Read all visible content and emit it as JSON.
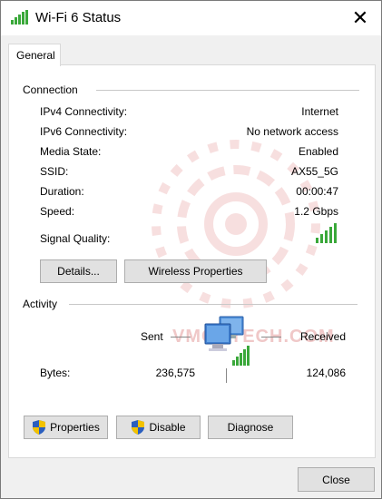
{
  "window": {
    "title": "Wi-Fi 6 Status",
    "close_glyph": "✕"
  },
  "tabs": [
    {
      "label": "General"
    }
  ],
  "connection": {
    "heading": "Connection",
    "rows": [
      {
        "label": "IPv4 Connectivity:",
        "value": "Internet"
      },
      {
        "label": "IPv6 Connectivity:",
        "value": "No network access"
      },
      {
        "label": "Media State:",
        "value": "Enabled"
      },
      {
        "label": "SSID:",
        "value": "AX55_5G"
      },
      {
        "label": "Duration:",
        "value": "00:00:47"
      },
      {
        "label": "Speed:",
        "value": "1.2 Gbps"
      }
    ],
    "signal_label": "Signal Quality:",
    "signal_bars_filled": 5,
    "signal_bars_total": 5,
    "details_label": "Details...",
    "wireless_properties_label": "Wireless Properties"
  },
  "activity": {
    "heading": "Activity",
    "sent_label": "Sent",
    "received_label": "Received",
    "bytes_label": "Bytes:",
    "bytes_sent": "236,575",
    "bytes_received": "124,086"
  },
  "actions": {
    "properties_label": "Properties",
    "disable_label": "Disable",
    "diagnose_label": "Diagnose"
  },
  "footer": {
    "close_label": "Close"
  },
  "watermark": {
    "text": "VMODTECH.COM"
  },
  "icons": {
    "title": "wifi-signal-icon",
    "shield": "uac-shield-icon",
    "computers": "network-computers-icon"
  },
  "colors": {
    "signal_green": "#3aa83a",
    "shield_blue": "#2b5fbf",
    "shield_yellow": "#f2c200"
  }
}
